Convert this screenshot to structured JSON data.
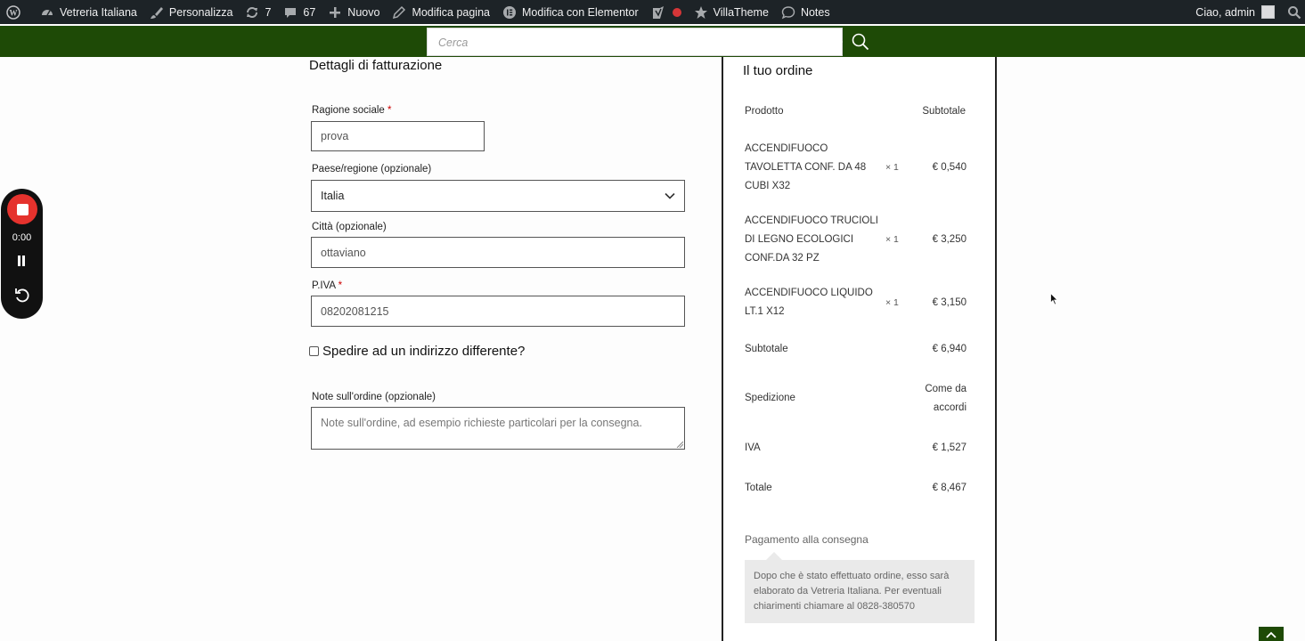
{
  "admin_bar": {
    "site_name": "Vetreria Italiana",
    "customize": "Personalizza",
    "updates_count": "7",
    "comments_count": "67",
    "new": "Nuovo",
    "edit_page": "Modifica pagina",
    "edit_elementor": "Modifica con Elementor",
    "villatheme": "VillaTheme",
    "notes": "Notes",
    "greeting": "Ciao, admin"
  },
  "search": {
    "placeholder": "Cerca"
  },
  "billing": {
    "title": "Dettagli di fatturazione",
    "company_label": "Ragione sociale",
    "company_value": "prova",
    "country_label": "Paese/regione (opzionale)",
    "country_value": "Italia",
    "city_label": "Città (opzionale)",
    "city_value": "ottaviano",
    "vat_label": "P.IVA",
    "vat_value": "08202081215",
    "required_mark": "*",
    "ship_different_label": "Spedire ad un indirizzo differente?",
    "notes_label": "Note sull'ordine (opzionale)",
    "notes_placeholder": "Note sull'ordine, ad esempio richieste particolari per la consegna."
  },
  "order": {
    "title": "Il tuo ordine",
    "col_product": "Prodotto",
    "col_subtotal": "Subtotale",
    "items": [
      {
        "lines": [
          "ACCENDIFUOCO",
          "TAVOLETTA CONF. DA 48",
          "CUBI X32"
        ],
        "qty": "× 1",
        "price": "€ 0,540"
      },
      {
        "lines": [
          "ACCENDIFUOCO TRUCIOLI",
          "DI LEGNO ECOLOGICI",
          "CONF.DA 32 PZ"
        ],
        "qty": "× 1",
        "price": "€ 3,250"
      },
      {
        "lines": [
          "ACCENDIFUOCO LIQUIDO",
          "LT.1 X12"
        ],
        "qty": "× 1",
        "price": "€ 3,150"
      }
    ],
    "subtotal_label": "Subtotale",
    "subtotal_value": "€ 6,940",
    "shipping_label": "Spedizione",
    "shipping_value_1": "Come da",
    "shipping_value_2": "accordi",
    "vat_label": "IVA",
    "vat_value": "€ 1,527",
    "total_label": "Totale",
    "total_value": "€ 8,467",
    "payment_method": "Pagamento alla consegna",
    "payment_description": "Dopo che è stato effettuato ordine, esso sarà elaborato da Vetreria Italiana. Per eventuali chiarimenti chiamare al 0828-380570"
  },
  "recorder": {
    "time": "0:00"
  },
  "colors": {
    "header_green": "#1e4a06",
    "admin_bar": "#1d2327",
    "record_red": "#e5322d"
  }
}
